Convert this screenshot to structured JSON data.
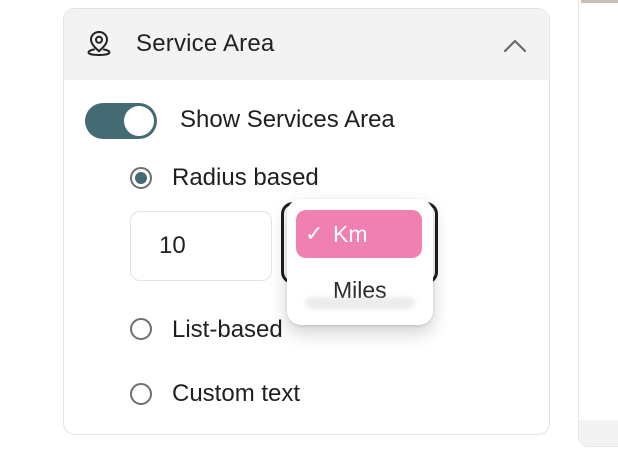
{
  "section": {
    "title": "Service Area",
    "icon": "location-pin-icon",
    "collapse_icon": "chevron-up-icon"
  },
  "toggle": {
    "label": "Show Services Area",
    "on": true,
    "color": "#446a73"
  },
  "options": {
    "radius": {
      "label": "Radius based",
      "checked": true
    },
    "list": {
      "label": "List-based",
      "checked": false
    },
    "custom": {
      "label": "Custom text",
      "checked": false
    }
  },
  "radius_input": {
    "value": "10"
  },
  "unit_dropdown": {
    "selected": "Km",
    "items": [
      "Km",
      "Miles"
    ],
    "highlight_color": "#f07fb2"
  }
}
